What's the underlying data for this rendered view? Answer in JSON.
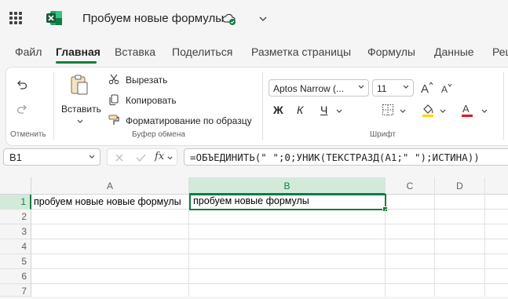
{
  "titlebar": {
    "doc_title": "Пробуем новые формулы"
  },
  "tabs": [
    {
      "label": "Файл"
    },
    {
      "label": "Главная"
    },
    {
      "label": "Вставка"
    },
    {
      "label": "Поделиться"
    },
    {
      "label": "Разметка страницы"
    },
    {
      "label": "Формулы"
    },
    {
      "label": "Данные"
    },
    {
      "label": "Рец"
    }
  ],
  "ribbon": {
    "undo_group_label": "Отменить",
    "paste_label": "Вставить",
    "cut_label": "Вырезать",
    "copy_label": "Копировать",
    "format_painter_label": "Форматирование по образцу",
    "clipboard_group_label": "Буфер обмена",
    "font_name": "Aptos Narrow (...",
    "font_size": "11",
    "bold_label": "Ж",
    "italic_label": "К",
    "underline_label": "Ч",
    "font_group_label": "Шрифт",
    "accent_color": "#107c41",
    "highlight_color": "#ffd400",
    "font_color": "#e81123"
  },
  "formula_bar": {
    "name_box": "B1",
    "fx_label": "fx",
    "formula": "=ОБЪЕДИНИТЬ(\" \";0;УНИК(ТЕКСТРАЗД(A1;\" \");ИСТИНА))"
  },
  "grid": {
    "columns": [
      "A",
      "B",
      "C",
      "D"
    ],
    "rows": [
      "1",
      "2",
      "3",
      "4",
      "5",
      "6",
      "7"
    ],
    "cells": {
      "A1": "пробуем новые новые формулы",
      "B1": "пробуем новые формулы"
    },
    "active_cell": "B1"
  }
}
